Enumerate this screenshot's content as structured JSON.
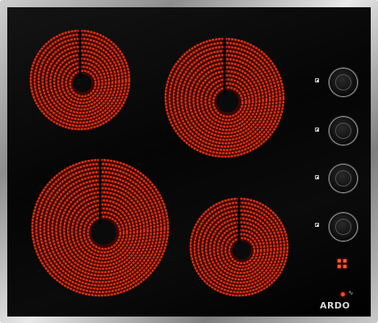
{
  "appliance": {
    "brand_name": "ARDO",
    "type": "ceramic-hob"
  },
  "hob": {
    "burners": [
      {
        "name": "rear-left-burner",
        "state": "on"
      },
      {
        "name": "rear-right-burner",
        "state": "on"
      },
      {
        "name": "front-left-burner",
        "state": "on"
      },
      {
        "name": "front-right-burner",
        "state": "on"
      }
    ],
    "knobs": [
      {
        "name": "control-knob-1"
      },
      {
        "name": "control-knob-2"
      },
      {
        "name": "control-knob-3"
      },
      {
        "name": "control-knob-4"
      }
    ],
    "power_symbol": "∿"
  },
  "colors": {
    "glass": "#000000",
    "coil": "#e03010",
    "frame": "#b0b0b0",
    "indicator": "#ff5b2a"
  }
}
